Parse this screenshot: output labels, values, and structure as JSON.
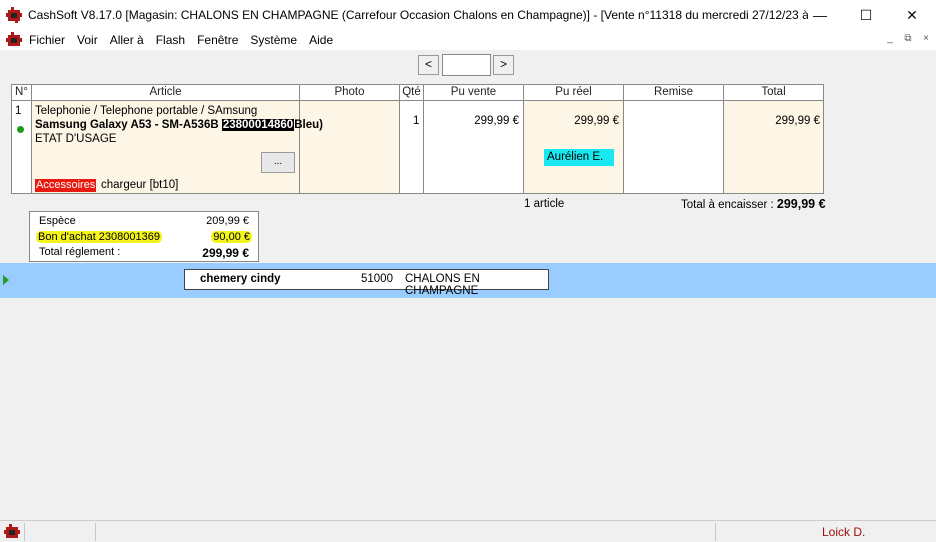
{
  "window": {
    "title": "CashSoft V8.17.0 [Magasin: CHALONS EN CHAMPAGNE (Carrefour Occasion Chalons en Champagne)] - [Vente n°11318 du mercredi 27/12/23 à ...",
    "minimize": "—",
    "maximize": "☐",
    "close": "✕"
  },
  "menu": {
    "items": [
      "Fichier",
      "Voir",
      "Aller à",
      "Flash",
      "Fenêtre",
      "Système",
      "Aide"
    ],
    "mdi_minimize": "_",
    "mdi_restore": "⧉",
    "mdi_close": "×"
  },
  "nav": {
    "prev": "<",
    "next": ">",
    "value": ""
  },
  "table": {
    "headers": [
      "N°",
      "Article",
      "Photo",
      "Qté",
      "Pu vente",
      "Pu réel",
      "Remise",
      "Total"
    ],
    "row": {
      "number": "1",
      "category": "Telephonie / Telephone portable / SAmsung",
      "name_prefix": "Samsung Galaxy A53 - SM-A536B ",
      "barcode": "23800014860",
      "name_suffix": "Bleu)",
      "condition": "ETAT D'USAGE",
      "more_button": "...",
      "accessories_label": "Accessoires",
      "accessories_value": "chargeur [bt10]",
      "quantity": "1",
      "unit_price": "299,99 €",
      "real_price": "299,99 €",
      "seller": "Aurélien E.",
      "discount": "",
      "total": "299,99 €"
    }
  },
  "summary": {
    "count": "1 article",
    "total_label": "Total à encaisser : ",
    "total_value": "299,99 €"
  },
  "payments": {
    "cash_label": "Espèce",
    "cash_value": "209,99 €",
    "voucher_label": "Bon d'achat 2308001369",
    "voucher_value": "90,00 €",
    "total_label": "Total réglement :",
    "total_value": "299,99 €"
  },
  "customer": {
    "name": "chemery cindy",
    "zip": "51000",
    "city": "CHALONS EN CHAMPAGNE"
  },
  "status": {
    "user": "Loick D."
  },
  "colors": {
    "selected_row_bg": "#99ccff",
    "highlight": "#f4f41a",
    "accessories": "#e8190e",
    "seller_badge": "#19e8f0",
    "cell_tint": "#fdf5e6",
    "status_user": "#a01010"
  }
}
